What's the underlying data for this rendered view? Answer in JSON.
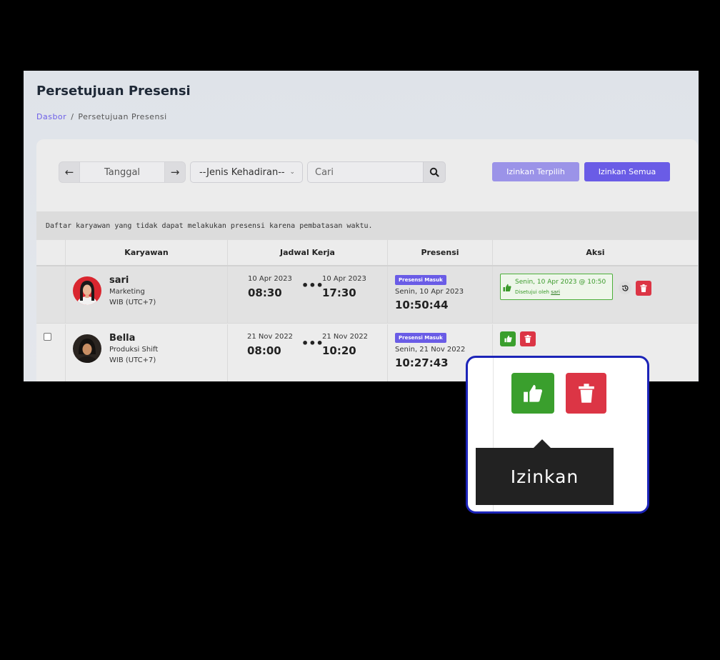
{
  "page": {
    "title": "Persetujuan Presensi",
    "breadcrumb": {
      "home": "Dasbor",
      "separator": "/",
      "current": "Persetujuan Presensi"
    }
  },
  "toolbar": {
    "date_placeholder": "Tanggal",
    "attendance_type_select": "--Jenis Kehadiran--",
    "search_placeholder": "Cari",
    "approve_selected_label": "Izinkan Terpilih",
    "approve_all_label": "Izinkan Semua"
  },
  "notice": "Daftar karyawan yang tidak dapat melakukan presensi karena pembatasan waktu.",
  "table": {
    "headers": [
      "Karyawan",
      "Jadwal Kerja",
      "Presensi",
      "Aksi"
    ],
    "rows": [
      {
        "name": "sari",
        "department": "Marketing",
        "timezone": "WIB (UTC+7)",
        "schedule_start_date": "10 Apr 2023",
        "schedule_start_time": "08:30",
        "schedule_separator": "•••",
        "schedule_end_date": "10 Apr 2023",
        "schedule_end_time": "17:30",
        "presence_badge": "Presensi Masuk",
        "presence_date": "Senin, 10 Apr 2023",
        "presence_time": "10:50:44",
        "approved_info": "Senin, 10 Apr 2023 @ 10:50",
        "approved_by_prefix": "Disetujui oleh",
        "approved_by_user": "sari"
      },
      {
        "name": "Bella",
        "department": "Produksi Shift",
        "timezone": "WIB (UTC+7)",
        "schedule_start_date": "21 Nov 2022",
        "schedule_start_time": "08:00",
        "schedule_separator": "•••",
        "schedule_end_date": "21 Nov 2022",
        "schedule_end_time": "10:20",
        "presence_badge": "Presensi Masuk",
        "presence_date": "Senin, 21 Nov 2022",
        "presence_time": "10:27:43"
      }
    ]
  },
  "zoom_callout": {
    "tooltip": "Izinkan"
  },
  "colors": {
    "accent": "#6a5ce6",
    "approve": "#3a9f2d",
    "delete": "#dc3545",
    "callout_border": "#1c24b8"
  }
}
